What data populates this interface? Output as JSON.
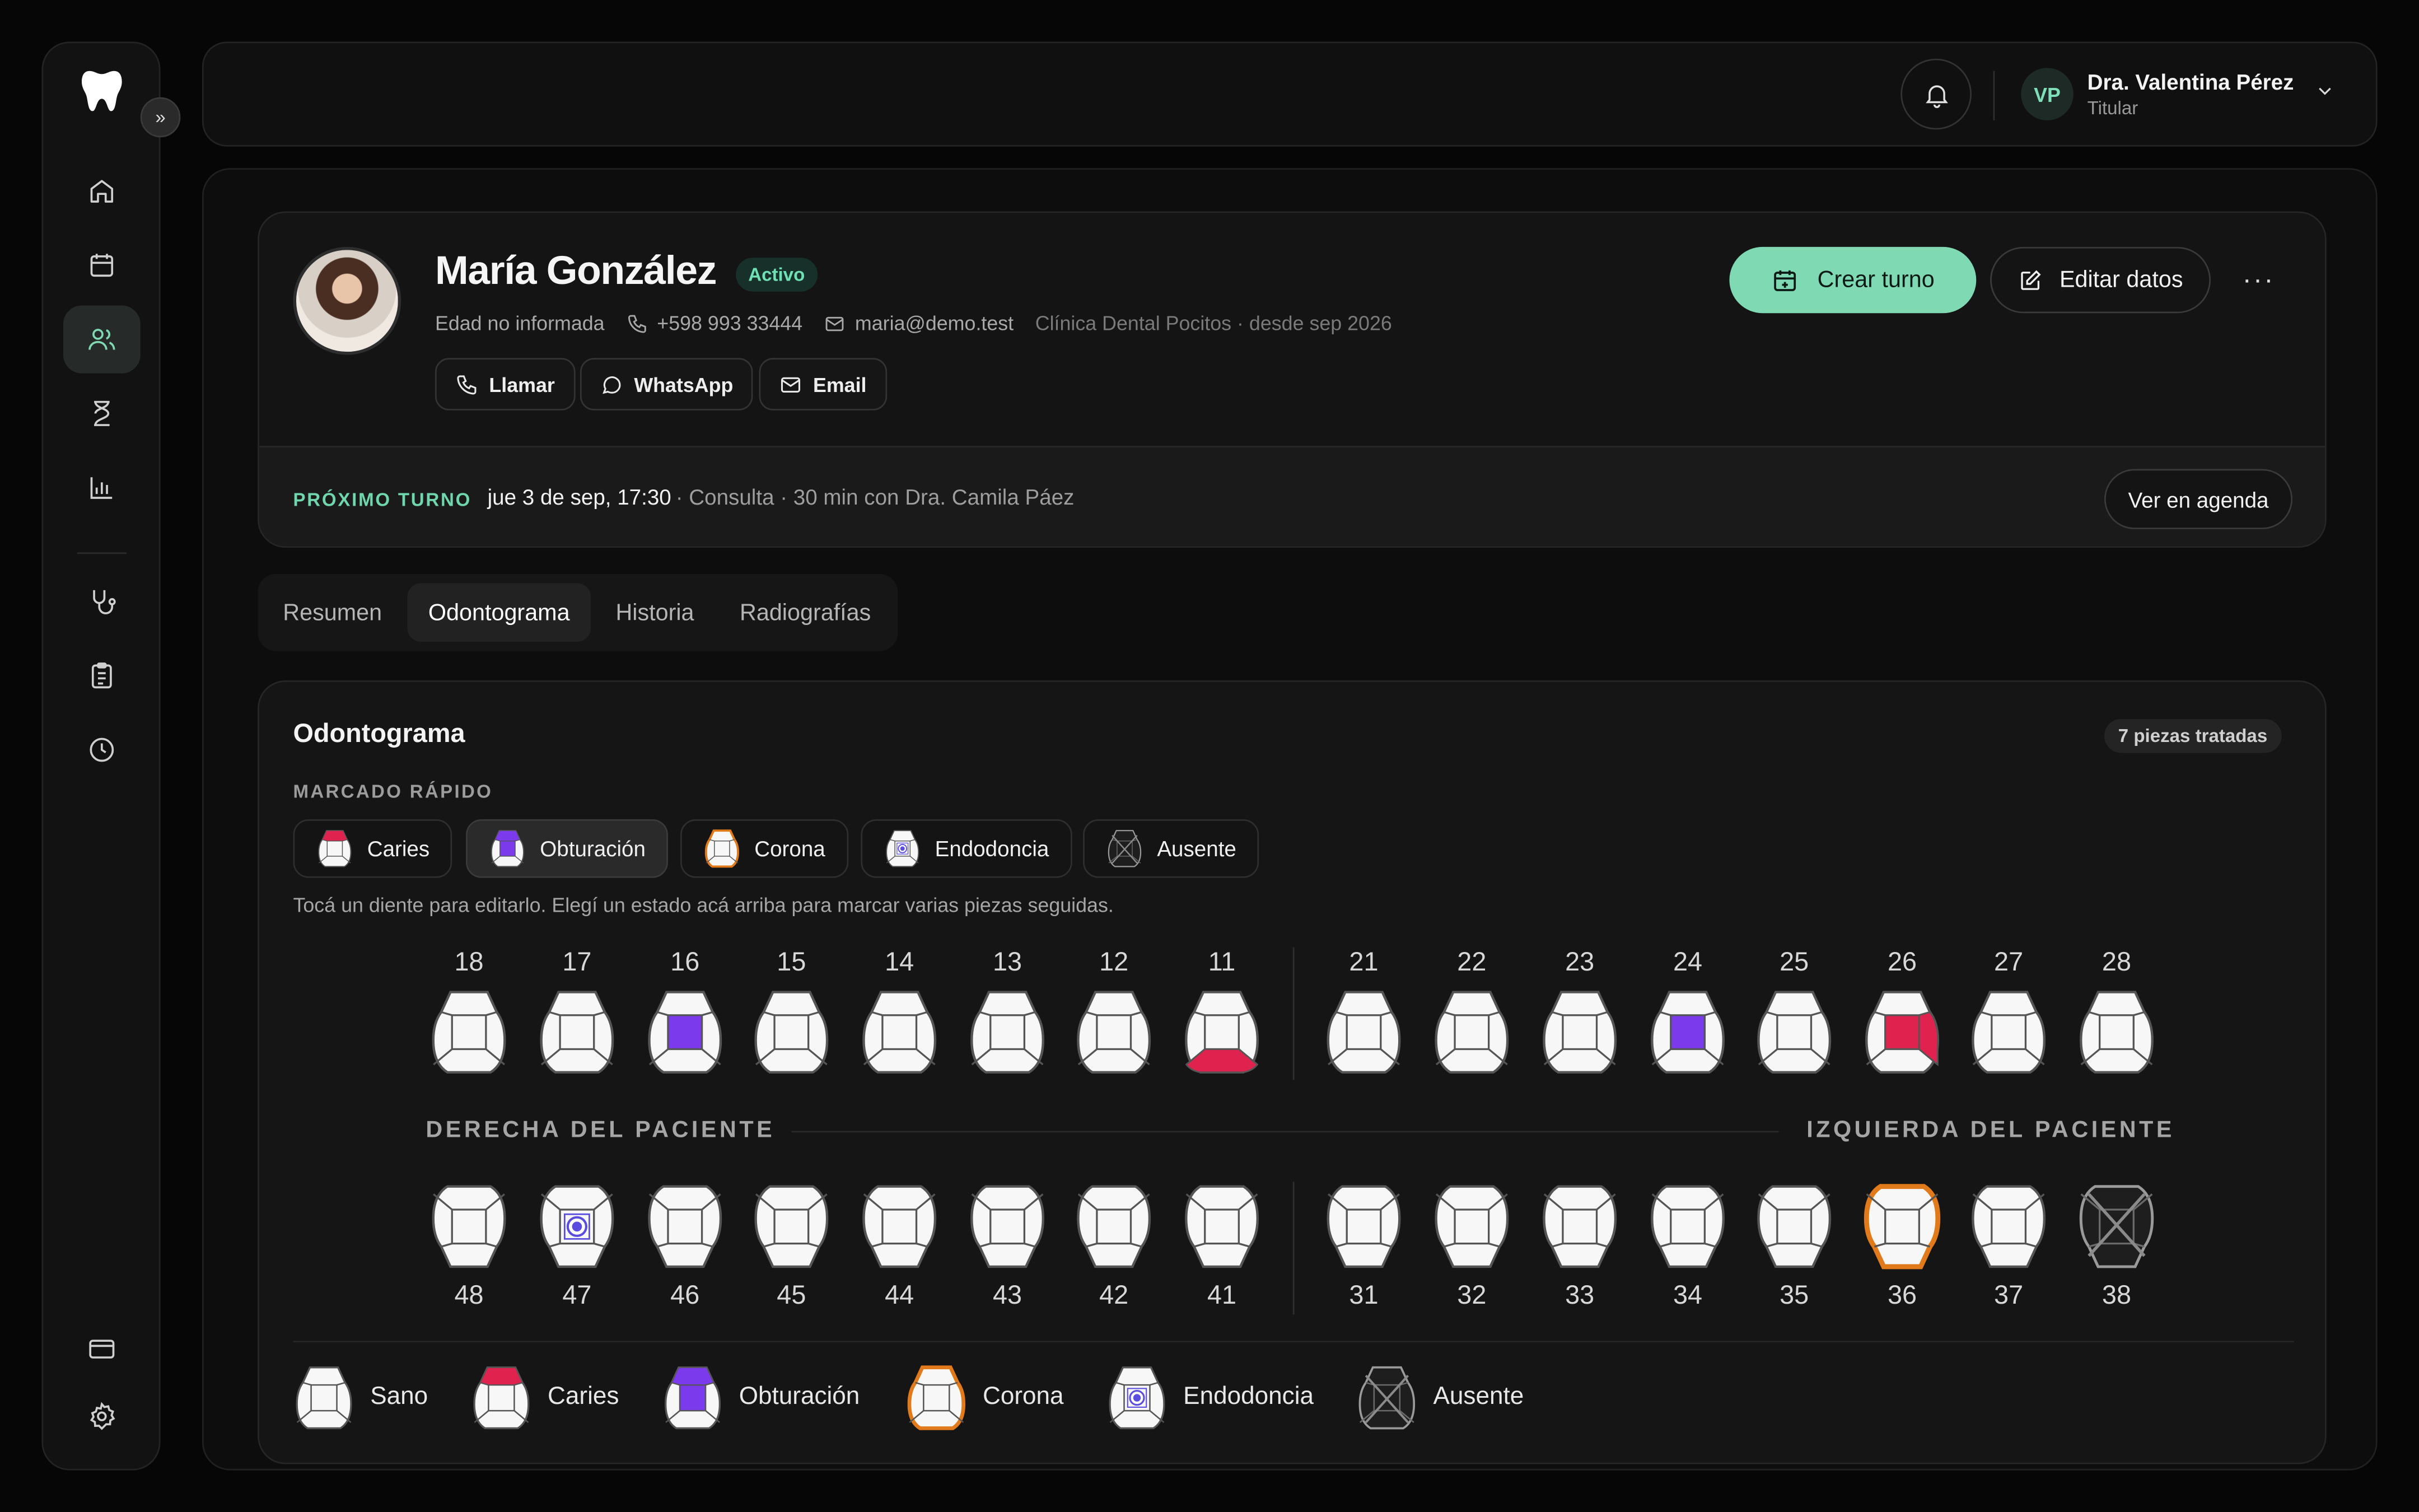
{
  "sidebar": {
    "logo_icon": "tooth-icon",
    "expand_icon": "chevrons-right-icon",
    "items": [
      {
        "icon": "home-icon",
        "active": false
      },
      {
        "icon": "calendar-icon",
        "active": false
      },
      {
        "icon": "users-icon",
        "active": true
      },
      {
        "icon": "hourglass-icon",
        "active": false
      },
      {
        "icon": "bar-chart-icon",
        "active": false
      },
      {
        "icon": "stethoscope-icon",
        "active": false
      },
      {
        "icon": "clipboard-icon",
        "active": false
      },
      {
        "icon": "clock-icon",
        "active": false
      },
      {
        "icon": "credit-card-icon",
        "active": false
      },
      {
        "icon": "settings-icon",
        "active": false
      }
    ]
  },
  "topbar": {
    "user_initials": "VP",
    "user_name": "Dra. Valentina Pérez",
    "user_role": "Titular"
  },
  "patient": {
    "name": "María González",
    "status": "Activo",
    "age": "Edad no informada",
    "phone": "+598 993 33444",
    "email": "maria@demo.test",
    "clinic": "Clínica Dental Pocitos · desde sep 2026",
    "contact_buttons": {
      "call": "Llamar",
      "whatsapp": "WhatsApp",
      "email": "Email"
    },
    "actions": {
      "create": "Crear turno",
      "edit": "Editar datos",
      "more": "···"
    }
  },
  "next_appointment": {
    "label": "PRÓXIMO TURNO",
    "when": "jue 3 de sep, 17:30",
    "detail": "· Consulta · 30 min con Dra. Camila Páez",
    "agenda_button": "Ver en agenda"
  },
  "tabs": [
    {
      "label": "Resumen",
      "active": false
    },
    {
      "label": "Odontograma",
      "active": true
    },
    {
      "label": "Historia",
      "active": false
    },
    {
      "label": "Radiografías",
      "active": false
    }
  ],
  "odontogram": {
    "title": "Odontograma",
    "treated_badge": "7 piezas tratadas",
    "quick_label": "MARCADO RÁPIDO",
    "quick_buttons": [
      {
        "label": "Caries",
        "state": "caries",
        "selected": false
      },
      {
        "label": "Obturación",
        "state": "obturacion",
        "selected": true
      },
      {
        "label": "Corona",
        "state": "corona",
        "selected": false
      },
      {
        "label": "Endodoncia",
        "state": "endodoncia",
        "selected": false
      },
      {
        "label": "Ausente",
        "state": "ausente",
        "selected": false
      }
    ],
    "hint": "Tocá un diente para editarlo. Elegí un estado acá arriba para marcar varias piezas seguidas.",
    "right_label": "DERECHA DEL PACIENTE",
    "left_label": "IZQUIERDA DEL PACIENTE",
    "upper": [
      {
        "n": "18",
        "state": "sano"
      },
      {
        "n": "17",
        "state": "sano"
      },
      {
        "n": "16",
        "state": "obturacion-occlusal"
      },
      {
        "n": "15",
        "state": "sano"
      },
      {
        "n": "14",
        "state": "sano"
      },
      {
        "n": "13",
        "state": "sano"
      },
      {
        "n": "12",
        "state": "sano"
      },
      {
        "n": "11",
        "state": "caries-bottom"
      },
      {
        "n": "21",
        "state": "sano"
      },
      {
        "n": "22",
        "state": "sano"
      },
      {
        "n": "23",
        "state": "sano"
      },
      {
        "n": "24",
        "state": "obturacion-occlusal"
      },
      {
        "n": "25",
        "state": "sano"
      },
      {
        "n": "26",
        "state": "caries-occlusal-right"
      },
      {
        "n": "27",
        "state": "sano"
      },
      {
        "n": "28",
        "state": "sano"
      }
    ],
    "lower": [
      {
        "n": "48",
        "state": "sano"
      },
      {
        "n": "47",
        "state": "endodoncia"
      },
      {
        "n": "46",
        "state": "sano"
      },
      {
        "n": "45",
        "state": "sano"
      },
      {
        "n": "44",
        "state": "sano"
      },
      {
        "n": "43",
        "state": "sano"
      },
      {
        "n": "42",
        "state": "sano"
      },
      {
        "n": "41",
        "state": "sano"
      },
      {
        "n": "31",
        "state": "sano"
      },
      {
        "n": "32",
        "state": "sano"
      },
      {
        "n": "33",
        "state": "sano"
      },
      {
        "n": "34",
        "state": "sano"
      },
      {
        "n": "35",
        "state": "sano"
      },
      {
        "n": "36",
        "state": "corona"
      },
      {
        "n": "37",
        "state": "sano"
      },
      {
        "n": "38",
        "state": "ausente"
      }
    ],
    "legend": [
      {
        "label": "Sano",
        "state": "sano"
      },
      {
        "label": "Caries",
        "state": "caries"
      },
      {
        "label": "Obturación",
        "state": "obturacion"
      },
      {
        "label": "Corona",
        "state": "corona"
      },
      {
        "label": "Endodoncia",
        "state": "endodoncia"
      },
      {
        "label": "Ausente",
        "state": "ausente"
      }
    ]
  },
  "colors": {
    "accent": "#7fd9b3",
    "caries": "#e0234e",
    "obturacion": "#7c3aed",
    "corona": "#e07a1a",
    "endodoncia": "#5b4ce0",
    "tooth_fill": "#f7f7f7",
    "tooth_stroke": "#555555"
  }
}
